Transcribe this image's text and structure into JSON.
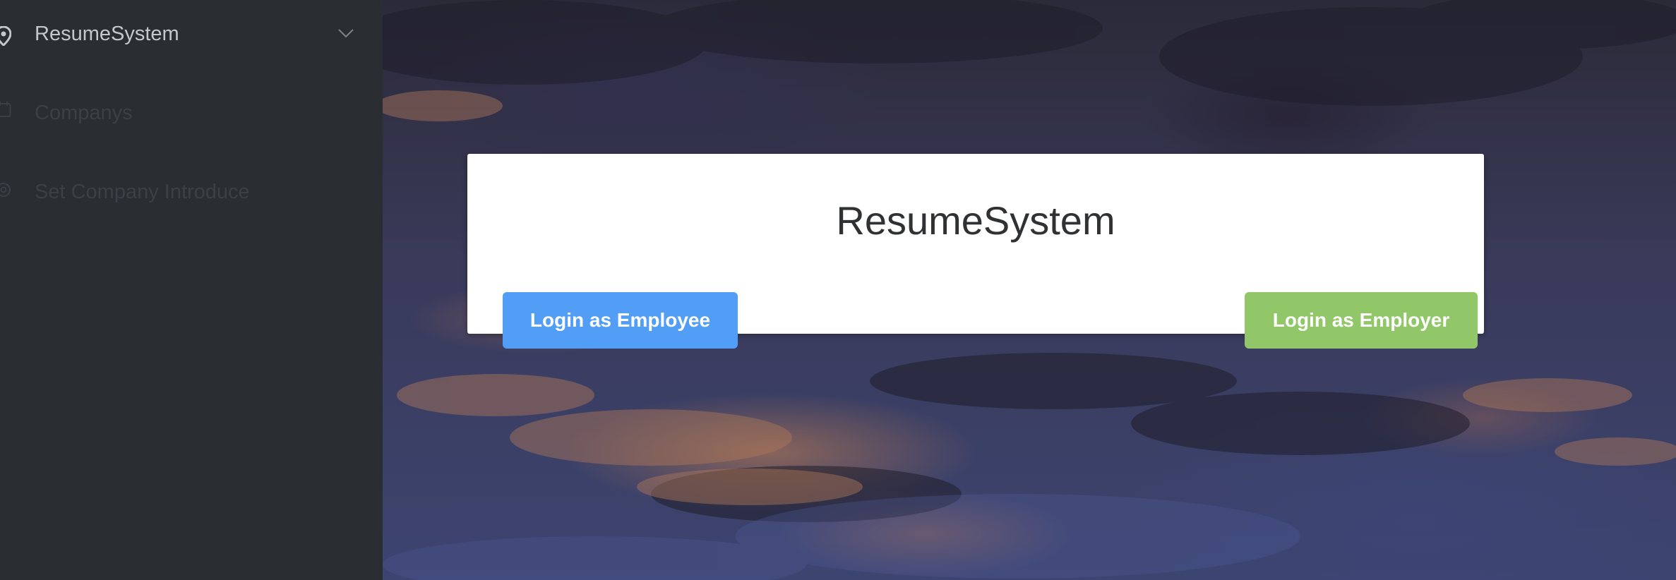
{
  "sidebar": {
    "items": [
      {
        "label": "ResumeSystem",
        "icon": "location-pin-icon",
        "expanded": true
      },
      {
        "label": "Companys",
        "icon": "calendar-icon"
      },
      {
        "label": "Set Company Introduce",
        "icon": "settings-icon"
      }
    ]
  },
  "login_card": {
    "title": "ResumeSystem",
    "employee_button": "Login as Employee",
    "employer_button": "Login as Employer"
  },
  "colors": {
    "sidebar_bg": "#2a2d32",
    "employee_button": "#529ef6",
    "employer_button": "#91c768"
  }
}
